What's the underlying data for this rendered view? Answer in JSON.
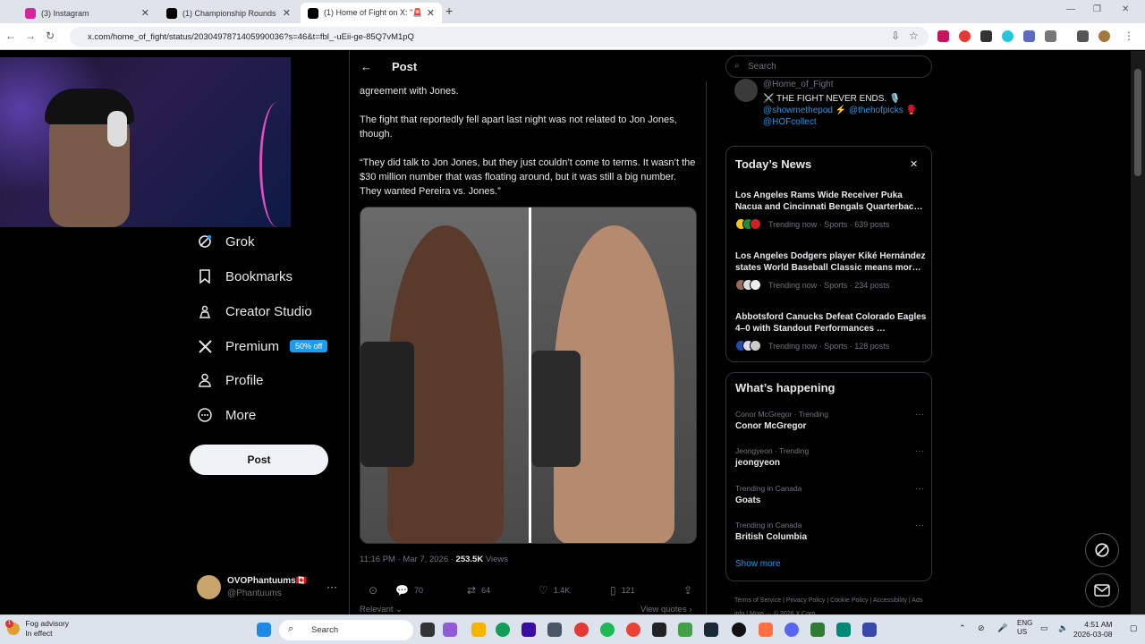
{
  "browser": {
    "tabs": [
      {
        "title": "(3) Instagram",
        "color": "#d6249f"
      },
      {
        "title": "(1) Championship Rounds on X:",
        "color": "#000000"
      },
      {
        "title": "(1) Home of Fight on X: \"🚨 us",
        "color": "#000000"
      }
    ],
    "url": "x.com/home_of_fight/status/2030497871405990036?s=46&t=fbl_-uEii-ge-85Q7vM1pQ"
  },
  "leftnav": {
    "items": [
      {
        "label": "Grok"
      },
      {
        "label": "Bookmarks"
      },
      {
        "label": "Creator Studio"
      },
      {
        "label": "Premium",
        "badge": "50% off"
      },
      {
        "label": "Profile"
      },
      {
        "label": "More"
      }
    ],
    "post_button": "Post",
    "account": {
      "name": "OVOPhantuums🇨🇦",
      "handle": "@Phantuums",
      "more": "···"
    }
  },
  "post": {
    "header_title": "Post",
    "back_icon": "←",
    "paragraphs": [
      "agreement with Jones.",
      "The fight that reportedly fell apart last night was not related to Jon Jones, though.",
      "“They did talk to Jon Jones, but they just couldn’t come to terms. It wasn’t the $30 million number that was floating around, but it was still a big number. They wanted Pereira vs. Jones.”"
    ],
    "timestamp": "11:16 PM · Mar 7, 2026 · ",
    "views_count": "253.5K",
    "views_label": " Views",
    "actions": {
      "replies": "70",
      "reposts": "64",
      "likes": "1.4K",
      "bookmarks": "121"
    },
    "relevant": "Relevant ⌄",
    "view_quotes": "View quotes ›"
  },
  "right": {
    "search_placeholder": "Search",
    "profile_snippet": {
      "handle": "@Home_of_Fight",
      "bio": "⚔️ THE FIGHT NEVER ENDS. 🎙️",
      "links": "@showmethepod ⚡ @thehofpicks 🥊 @HOFcollect"
    },
    "news": {
      "title": "Today’s News",
      "close": "✕",
      "items": [
        {
          "headline": "Los Angeles Rams Wide Receiver Puka Nacua and Cincinnati Bengals Quarterbac…",
          "sub": "Trending now · Sports · 639 posts"
        },
        {
          "headline": "Los Angeles Dodgers player Kiké Hernández states World Baseball Classic means mor…",
          "sub": "Trending now · Sports · 234 posts"
        },
        {
          "headline": "Abbotsford Canucks Defeat Colorado Eagles 4–0 with Standout Performances …",
          "sub": "Trending now · Sports · 128 posts"
        }
      ]
    },
    "happening": {
      "title": "What’s happening",
      "items": [
        {
          "context": "Conor McGregor · Trending",
          "name": "Conor McGregor"
        },
        {
          "context": "Jeongyeon · Trending",
          "name": "jeongyeon"
        },
        {
          "context": "Trending in Canada",
          "name": "Goats"
        },
        {
          "context": "Trending in Canada",
          "name": "British Columbia"
        }
      ],
      "show_more": "Show more",
      "more_icon": "···"
    },
    "footer": "Terms of Service  |  Privacy Policy  |  Cookie Policy  |  Accessibility  |  Ads info  |  More ···  © 2026 X Corp."
  },
  "taskbar": {
    "weather_title": "Fog advisory",
    "weather_sub": "In effect",
    "weather_badge": "1",
    "search": "Search",
    "lang": "ENG",
    "region": "US",
    "time": "4:51 AM",
    "date": "2026-03-08"
  }
}
